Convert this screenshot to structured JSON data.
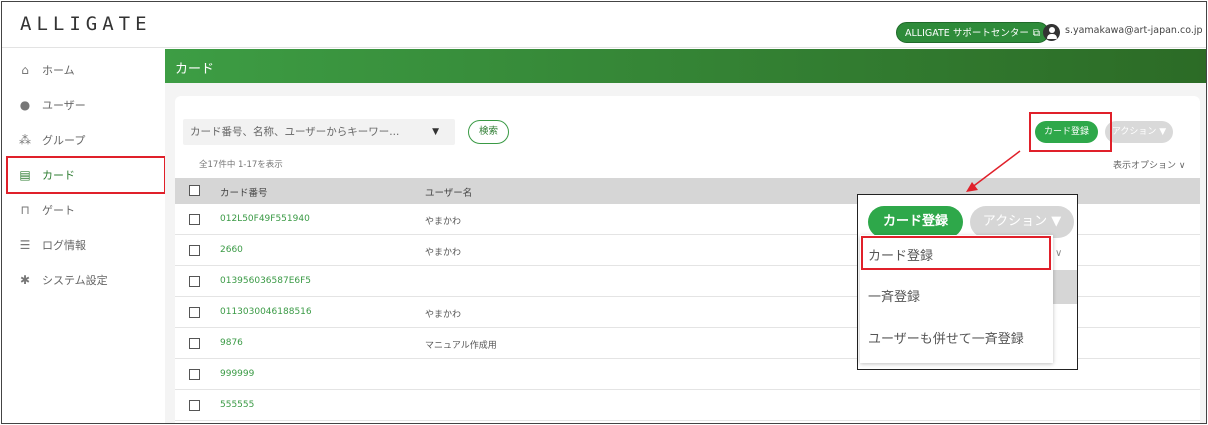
{
  "header": {
    "logo": "ALLIGATE",
    "support_label": "ALLIGATE サポートセンター",
    "support_icon": "external-link-icon",
    "user_email": "s.yamakawa@art-japan.co.jp"
  },
  "sidebar": {
    "items": [
      {
        "label": "ホーム",
        "icon": "home-icon"
      },
      {
        "label": "ユーザー",
        "icon": "user-icon"
      },
      {
        "label": "グループ",
        "icon": "group-icon"
      },
      {
        "label": "カード",
        "icon": "card-icon"
      },
      {
        "label": "ゲート",
        "icon": "gate-icon"
      },
      {
        "label": "ログ情報",
        "icon": "list-icon"
      },
      {
        "label": "システム設定",
        "icon": "gear-icon"
      }
    ]
  },
  "page": {
    "title": "カード"
  },
  "toolbar": {
    "search_placeholder": "カード番号、名称、ユーザーからキーワー...",
    "search_button": "検索",
    "card_register": "カード登録",
    "action": "アクション ▼",
    "count_text": "全17件中 1-17を表示",
    "display_options": "表示オプション"
  },
  "table": {
    "columns": [
      "カード番号",
      "ユーザー名"
    ],
    "rows": [
      {
        "card": "012L50F49F551940",
        "user": "やまかわ"
      },
      {
        "card": "2660",
        "user": "やまかわ"
      },
      {
        "card": "013956036587E6F5",
        "user": ""
      },
      {
        "card": "0113030046188516",
        "user": "やまかわ"
      },
      {
        "card": "9876",
        "user": "マニュアル作成用"
      },
      {
        "card": "999999",
        "user": ""
      },
      {
        "card": "555555",
        "user": ""
      }
    ]
  },
  "callout": {
    "register_button": "カード登録",
    "action_button": "アクション ▼",
    "menu_items": [
      "カード登録",
      "一斉登録",
      "ユーザーも併せて一斉登録"
    ]
  },
  "colors": {
    "accent_green": "#2ea84a",
    "banner_green": "#3d9d44",
    "highlight_red": "#e0202a"
  }
}
